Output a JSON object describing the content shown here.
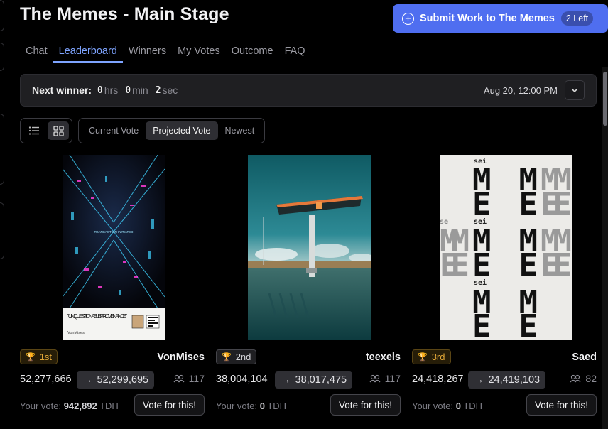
{
  "page": {
    "title": "The Memes - Main Stage"
  },
  "submit": {
    "label": "Submit Work to The Memes",
    "remaining": "2 Left"
  },
  "tabs": [
    {
      "label": "Chat"
    },
    {
      "label": "Leaderboard",
      "active": true
    },
    {
      "label": "Winners"
    },
    {
      "label": "My Votes"
    },
    {
      "label": "Outcome"
    },
    {
      "label": "FAQ"
    }
  ],
  "winner": {
    "label": "Next winner:",
    "hours": "0",
    "hours_unit": "hrs",
    "minutes": "0",
    "minutes_unit": "min",
    "seconds": "2",
    "seconds_unit": "sec",
    "date": "Aug 20, 12:00 PM"
  },
  "sort": {
    "current": "Current Vote",
    "projected": "Projected Vote",
    "newest": "Newest",
    "active": "Projected Vote"
  },
  "cards": [
    {
      "rank": "1st",
      "artist": "VonMises",
      "current_vote": "52,277,666",
      "projected_vote": "52,299,695",
      "voters": "117",
      "your_vote_label": "Your vote:",
      "your_vote_value": "942,892",
      "your_vote_unit": "TDH",
      "vote_button": "Vote for this!",
      "art": {
        "caption": "\"UNQUESTIONABLE PROVENANCE\"",
        "signature": "VonMises",
        "mid_text": "TRANSACTION INITIATED"
      }
    },
    {
      "rank": "2nd",
      "artist": "teexels",
      "current_vote": "38,004,104",
      "projected_vote": "38,017,475",
      "voters": "117",
      "your_vote_label": "Your vote:",
      "your_vote_value": "0",
      "your_vote_unit": "TDH",
      "vote_button": "Vote for this!"
    },
    {
      "rank": "3rd",
      "artist": "Saed",
      "current_vote": "24,418,267",
      "projected_vote": "24,419,103",
      "voters": "82",
      "your_vote_label": "Your vote:",
      "your_vote_value": "0",
      "your_vote_unit": "TDH",
      "vote_button": "Vote for this!",
      "art": {
        "label": "sei",
        "label_partial": "se"
      }
    }
  ],
  "colors": {
    "accent": "#4f6ef0",
    "tab_active": "#7ea4ff",
    "gold": "#e0a637",
    "background": "#000000"
  }
}
